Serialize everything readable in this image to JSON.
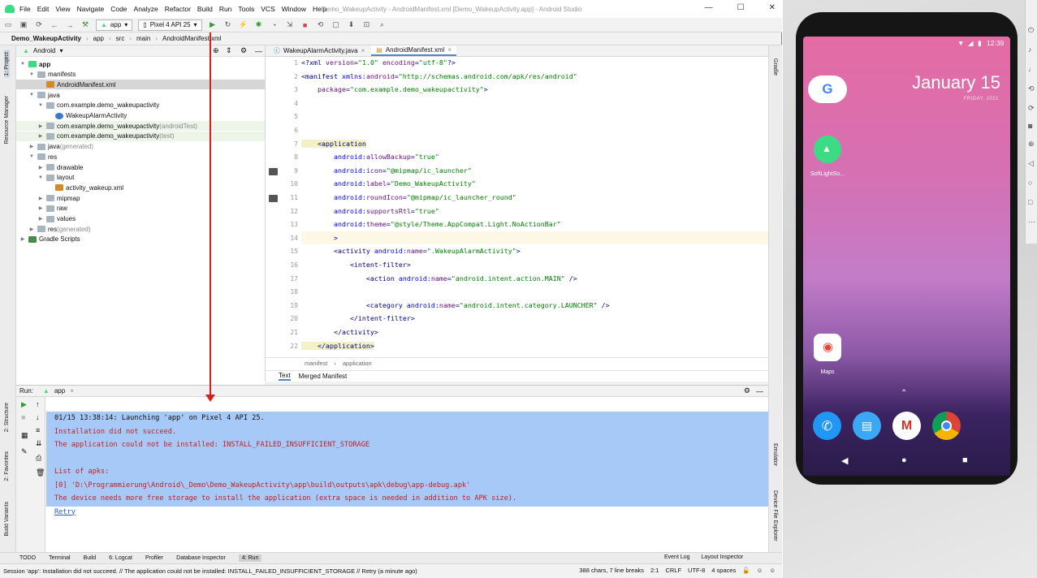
{
  "window": {
    "title": "Demo_WakeupActivity - AndroidManifest.xml [Demo_WakeupActivity.app] - Android Studio",
    "menu": [
      "File",
      "Edit",
      "View",
      "Navigate",
      "Code",
      "Analyze",
      "Refactor",
      "Build",
      "Run",
      "Tools",
      "VCS",
      "Window",
      "Help"
    ]
  },
  "toolbar": {
    "config": "app",
    "device": "Pixel 4 API 25"
  },
  "breadcrumbs": [
    "Demo_WakeupActivity",
    "app",
    "src",
    "main",
    "AndroidManifest.xml"
  ],
  "left_strip": [
    "1: Project",
    "Resource Manager",
    "2: Structure",
    "2: Favorites",
    "Build Variants"
  ],
  "right_strip": [
    "Gradle",
    "Emulator",
    "Device File Explorer"
  ],
  "project": {
    "view": "Android",
    "tree": [
      {
        "label": "app",
        "suffix": "",
        "depth": 0,
        "type": "module",
        "bold": true
      },
      {
        "label": "manifests",
        "suffix": "",
        "depth": 1,
        "type": "folder"
      },
      {
        "label": "AndroidManifest.xml",
        "suffix": "",
        "depth": 2,
        "type": "file",
        "selected": true
      },
      {
        "label": "java",
        "suffix": "",
        "depth": 1,
        "type": "folder"
      },
      {
        "label": "com.example.demo_wakeupactivity",
        "suffix": "",
        "depth": 2,
        "type": "package"
      },
      {
        "label": "WakeupAlarmActivity",
        "suffix": "",
        "depth": 3,
        "type": "class"
      },
      {
        "label": "com.example.demo_wakeupactivity",
        "suffix": " (androidTest)",
        "depth": 2,
        "type": "package",
        "tinted": true
      },
      {
        "label": "com.example.demo_wakeupactivity",
        "suffix": " (test)",
        "depth": 2,
        "type": "package",
        "tinted": true
      },
      {
        "label": "java",
        "suffix": " (generated)",
        "depth": 1,
        "type": "folder"
      },
      {
        "label": "res",
        "suffix": "",
        "depth": 1,
        "type": "folder"
      },
      {
        "label": "drawable",
        "suffix": "",
        "depth": 2,
        "type": "folder"
      },
      {
        "label": "layout",
        "suffix": "",
        "depth": 2,
        "type": "folder"
      },
      {
        "label": "activity_wakeup.xml",
        "suffix": "",
        "depth": 3,
        "type": "file"
      },
      {
        "label": "mipmap",
        "suffix": "",
        "depth": 2,
        "type": "folder"
      },
      {
        "label": "raw",
        "suffix": "",
        "depth": 2,
        "type": "folder"
      },
      {
        "label": "values",
        "suffix": "",
        "depth": 2,
        "type": "folder"
      },
      {
        "label": "res",
        "suffix": " (generated)",
        "depth": 1,
        "type": "folder"
      },
      {
        "label": "Gradle Scripts",
        "suffix": "",
        "depth": 0,
        "type": "gradle"
      }
    ]
  },
  "editor": {
    "tabs": [
      "WakeupAlarmActivity.java",
      "AndroidManifest.xml"
    ],
    "active_tab": 1,
    "lines": [
      [
        [
          "t",
          "<?xml "
        ],
        [
          "a",
          "version"
        ],
        [
          "t",
          "="
        ],
        [
          "v",
          "\"1.0\""
        ],
        [
          "t",
          " "
        ],
        [
          "a",
          "encoding"
        ],
        [
          "t",
          "="
        ],
        [
          "v",
          "\"utf-8\""
        ],
        [
          "t",
          "?>"
        ]
      ],
      [
        [
          "t",
          "<manifest "
        ],
        [
          "n",
          "xmlns:"
        ],
        [
          "a",
          "android"
        ],
        [
          "t",
          "="
        ],
        [
          "v",
          "\"http://schemas.android.com/apk/res/android\""
        ]
      ],
      [
        [
          "t",
          "    "
        ],
        [
          "a",
          "package"
        ],
        [
          "t",
          "="
        ],
        [
          "v",
          "\"com.example.demo_wakeupactivity\""
        ],
        [
          "t",
          ">"
        ]
      ],
      [],
      [],
      [],
      [
        [
          "t",
          "    <application"
        ]
      ],
      [
        [
          "t",
          "        "
        ],
        [
          "n",
          "android:"
        ],
        [
          "a",
          "allowBackup"
        ],
        [
          "t",
          "="
        ],
        [
          "v",
          "\"true\""
        ]
      ],
      [
        [
          "t",
          "        "
        ],
        [
          "n",
          "android:"
        ],
        [
          "a",
          "icon"
        ],
        [
          "t",
          "="
        ],
        [
          "v",
          "\"@mipmap/ic_launcher\""
        ]
      ],
      [
        [
          "t",
          "        "
        ],
        [
          "n",
          "android:"
        ],
        [
          "a",
          "label"
        ],
        [
          "t",
          "="
        ],
        [
          "v",
          "\"Demo_WakeupActivity\""
        ]
      ],
      [
        [
          "t",
          "        "
        ],
        [
          "n",
          "android:"
        ],
        [
          "a",
          "roundIcon"
        ],
        [
          "t",
          "="
        ],
        [
          "v",
          "\"@mipmap/ic_launcher_round\""
        ]
      ],
      [
        [
          "t",
          "        "
        ],
        [
          "n",
          "android:"
        ],
        [
          "a",
          "supportsRtl"
        ],
        [
          "t",
          "="
        ],
        [
          "v",
          "\"true\""
        ]
      ],
      [
        [
          "t",
          "        "
        ],
        [
          "n",
          "android:"
        ],
        [
          "a",
          "theme"
        ],
        [
          "t",
          "="
        ],
        [
          "v",
          "\"@style/Theme.AppCompat.Light.NoActionBar\""
        ]
      ],
      [
        [
          "t",
          "        >"
        ]
      ],
      [
        [
          "t",
          "        <activity "
        ],
        [
          "n",
          "android:"
        ],
        [
          "a",
          "name"
        ],
        [
          "t",
          "="
        ],
        [
          "v",
          "\".WakeupAlarmActivity\""
        ],
        [
          "t",
          ">"
        ]
      ],
      [
        [
          "t",
          "            <intent-filter>"
        ]
      ],
      [
        [
          "t",
          "                <action "
        ],
        [
          "n",
          "android:"
        ],
        [
          "a",
          "name"
        ],
        [
          "t",
          "="
        ],
        [
          "v",
          "\"android.intent.action.MAIN\""
        ],
        [
          "t",
          " />"
        ]
      ],
      [],
      [
        [
          "t",
          "                <category "
        ],
        [
          "n",
          "android:"
        ],
        [
          "a",
          "name"
        ],
        [
          "t",
          "="
        ],
        [
          "v",
          "\"android.intent.category.LAUNCHER\""
        ],
        [
          "t",
          " />"
        ]
      ],
      [
        [
          "t",
          "            </intent-filter>"
        ]
      ],
      [
        [
          "t",
          "        </activity>"
        ]
      ],
      [
        [
          "t",
          "    </application>"
        ]
      ]
    ],
    "breadcrumb": [
      "manifest",
      "application"
    ],
    "bottom_tabs": [
      "Text",
      "Merged Manifest"
    ]
  },
  "run": {
    "label": "Run:",
    "config": "app",
    "console": [
      {
        "text": "01/15 13:38:14: Launching 'app' on Pixel 4 API 25.",
        "style": "normal"
      },
      {
        "text": "Installation did not succeed.",
        "style": "error"
      },
      {
        "text": "The application could not be installed: INSTALL_FAILED_INSUFFICIENT_STORAGE",
        "style": "error"
      },
      {
        "text": "",
        "style": "normal"
      },
      {
        "text": "List of apks:",
        "style": "error"
      },
      {
        "text": "[0] 'D:\\Programmierung\\Android\\_Demo\\Demo_WakeupActivity\\app\\build\\outputs\\apk\\debug\\app-debug.apk'",
        "style": "error"
      },
      {
        "text": "The device needs more free storage to install the application (extra space is needed in addition to APK size).",
        "style": "error"
      },
      {
        "text": "Retry",
        "style": "link"
      }
    ]
  },
  "bottom_tools": [
    "TODO",
    "Terminal",
    "Build",
    "6: Logcat",
    "Profiler",
    "Database Inspector",
    "4: Run"
  ],
  "bottom_tools_right": [
    "Event Log",
    "Layout Inspector"
  ],
  "status": {
    "message": "Session 'app': Installation did not succeed. // The application could not be installed: INSTALL_FAILED_INSUFFICIENT_STORAGE // Retry (a minute ago)",
    "chars": "388 chars, 7 line breaks",
    "position": "2:1",
    "line_sep": "CRLF",
    "encoding": "UTF-8",
    "indent": "4 spaces"
  },
  "phone": {
    "time": "12:39",
    "date": "January 15",
    "date_sub": "FRIDAY, 2021",
    "app1": "SoftLightSo...",
    "app2": "Maps"
  },
  "colors": {
    "accent": "#4a88c7",
    "selection": "#a6c9f7",
    "error": "#c41e1e",
    "arrow": "#d62020"
  }
}
